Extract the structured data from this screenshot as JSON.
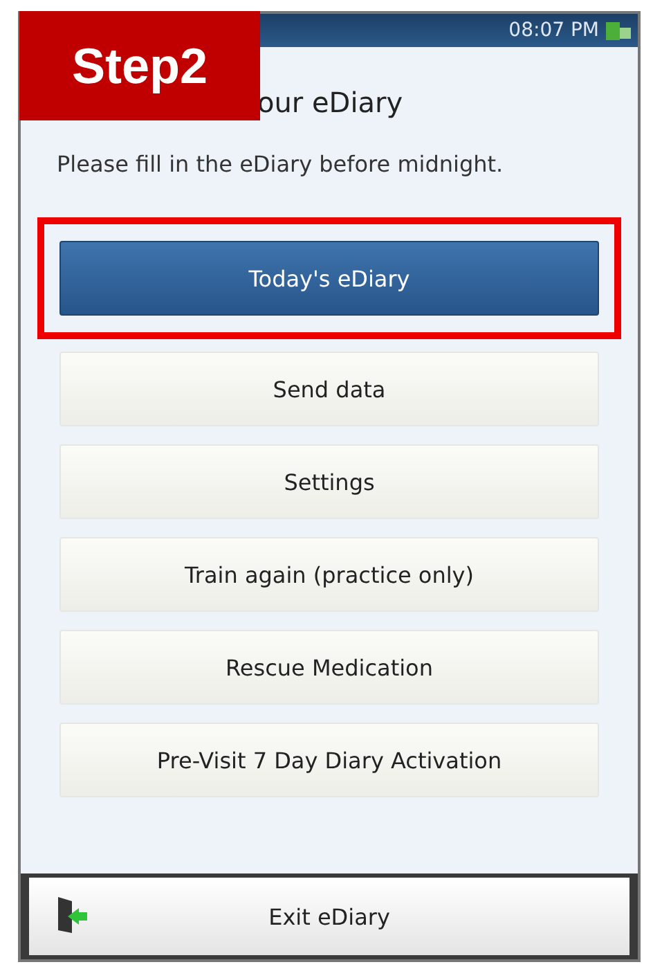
{
  "annotation": {
    "label": "Step2"
  },
  "status_bar": {
    "time": "08:07 PM"
  },
  "title": "our eDiary",
  "message": "Please fill in the eDiary before midnight.",
  "menu": [
    {
      "label": "Today's eDiary",
      "selected": true,
      "highlighted": true
    },
    {
      "label": "Send data",
      "selected": false,
      "highlighted": false
    },
    {
      "label": "Settings",
      "selected": false,
      "highlighted": false
    },
    {
      "label": "Train again (practice only)",
      "selected": false,
      "highlighted": false
    },
    {
      "label": "Rescue Medication",
      "selected": false,
      "highlighted": false
    },
    {
      "label": "Pre-Visit 7 Day Diary Activation",
      "selected": false,
      "highlighted": false
    }
  ],
  "exit_button": {
    "label": "Exit eDiary"
  }
}
